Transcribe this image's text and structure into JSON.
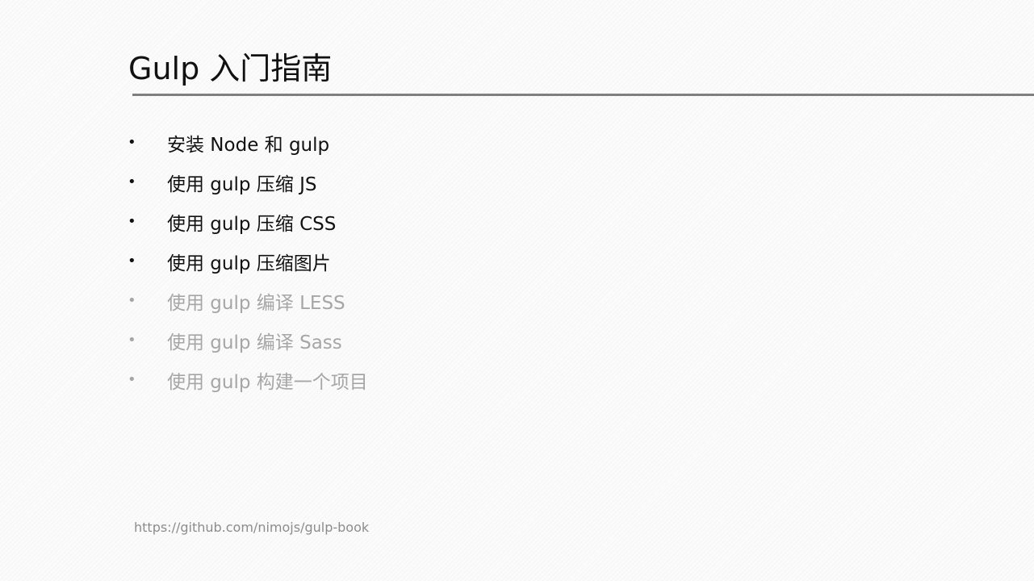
{
  "slide": {
    "title": "Gulp 入门指南",
    "bullet_glyph": "•",
    "items": [
      {
        "label": "安装 Node 和 gulp",
        "state": "active"
      },
      {
        "label": "使用 gulp 压缩 JS",
        "state": "active"
      },
      {
        "label": "使用 gulp 压缩 CSS",
        "state": "active"
      },
      {
        "label": "使用 gulp 压缩图片",
        "state": "active"
      },
      {
        "label": "使用 gulp 编译 LESS",
        "state": "dim"
      },
      {
        "label": "使用 gulp 编译 Sass",
        "state": "dim"
      },
      {
        "label": "使用 gulp 构建一个项目",
        "state": "dim"
      }
    ],
    "footer_url": "https://github.com/nimojs/gulp-book"
  },
  "colors": {
    "text_active": "#111111",
    "text_dim": "#a6a6a6",
    "rule": "#7f7f7f",
    "footer": "#8c8c8c"
  }
}
